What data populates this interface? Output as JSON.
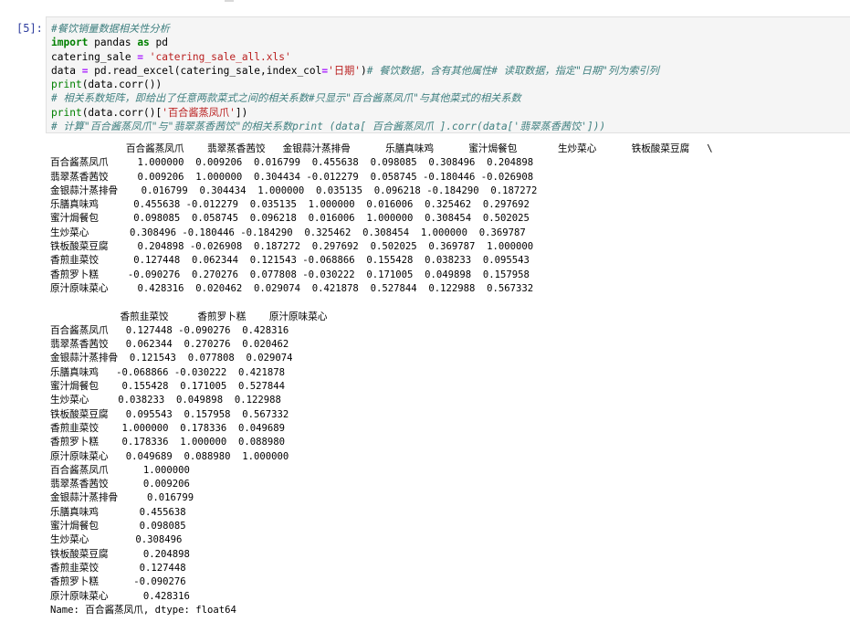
{
  "cell": {
    "prompt": "[5]:",
    "code": {
      "line1": "#餐饮销量数据相关性分析",
      "line2_kw1": "import",
      "line2_mod": " pandas ",
      "line2_kw2": "as",
      "line2_alias": " pd",
      "line3_var": "catering_sale ",
      "line3_op": "=",
      "line3_str": " 'catering_sale_all.xls'",
      "line4_a": "data ",
      "line4_op": "=",
      "line4_b": " pd.read_excel(catering_sale,index_col",
      "line4_op2": "=",
      "line4_str": "'日期'",
      "line4_c": ")",
      "line4_comment": "# 餐饮数据，含有其他属性# 读取数据，指定\"日期\"列为索引列",
      "line5_fn": "print",
      "line5_rest": "(data.corr())",
      "line6": "# 相关系数矩阵，即给出了任意两款菜式之间的相关系数#只显示\"百合酱蒸凤爪\"与其他菜式的相关系数",
      "line7_fn": "print",
      "line7_a": "(data.corr()[",
      "line7_str": "'百合酱蒸凤爪'",
      "line7_b": "])",
      "line8": "# 计算\"百合酱蒸凤爪\"与\"翡翠蒸香茜饺\"的相关系数print (data[ 百合酱蒸凤爪 ].corr(data['翡翠蒸香茜饺']))"
    },
    "output": {
      "block1_header": "             百合酱蒸凤爪    翡翠蒸香茜饺   金银蒜汁蒸排骨      乐膳真味鸡      蜜汁焗餐包       生炒菜心      铁板酸菜豆腐   \\",
      "block1_rows": [
        "百合酱蒸凤爪     1.000000  0.009206  0.016799  0.455638  0.098085  0.308496  0.204898",
        "翡翠蒸香茜饺     0.009206  1.000000  0.304434 -0.012279  0.058745 -0.180446 -0.026908",
        "金银蒜汁蒸排骨    0.016799  0.304434  1.000000  0.035135  0.096218 -0.184290  0.187272",
        "乐膳真味鸡      0.455638 -0.012279  0.035135  1.000000  0.016006  0.325462  0.297692",
        "蜜汁焗餐包      0.098085  0.058745  0.096218  0.016006  1.000000  0.308454  0.502025",
        "生炒菜心       0.308496 -0.180446 -0.184290  0.325462  0.308454  1.000000  0.369787",
        "铁板酸菜豆腐     0.204898 -0.026908  0.187272  0.297692  0.502025  0.369787  1.000000",
        "香煎韭菜饺      0.127448  0.062344  0.121543 -0.068866  0.155428  0.038233  0.095543",
        "香煎罗卜糕     -0.090276  0.270276  0.077808 -0.030222  0.171005  0.049898  0.157958",
        "原汁原味菜心     0.428316  0.020462  0.029074  0.421878  0.527844  0.122988  0.567332"
      ],
      "block2_header": "            香煎韭菜饺     香煎罗卜糕    原汁原味菜心",
      "block2_rows": [
        "百合酱蒸凤爪   0.127448 -0.090276  0.428316",
        "翡翠蒸香茜饺   0.062344  0.270276  0.020462",
        "金银蒜汁蒸排骨  0.121543  0.077808  0.029074",
        "乐膳真味鸡   -0.068866 -0.030222  0.421878",
        "蜜汁焗餐包    0.155428  0.171005  0.527844",
        "生炒菜心     0.038233  0.049898  0.122988",
        "铁板酸菜豆腐   0.095543  0.157958  0.567332",
        "香煎韭菜饺    1.000000  0.178336  0.049689",
        "香煎罗卜糕    0.178336  1.000000  0.088980",
        "原汁原味菜心   0.049689  0.088980  1.000000"
      ],
      "series_rows": [
        "百合酱蒸凤爪      1.000000",
        "翡翠蒸香茜饺      0.009206",
        "金银蒜汁蒸排骨     0.016799",
        "乐膳真味鸡       0.455638",
        "蜜汁焗餐包       0.098085",
        "生炒菜心        0.308496",
        "铁板酸菜豆腐      0.204898",
        "香煎韭菜饺       0.127448",
        "香煎罗卜糕      -0.090276",
        "原汁原味菜心      0.428316"
      ],
      "series_footer": "Name: 百合酱蒸凤爪, dtype: float64"
    }
  },
  "colors": {
    "prompt": "#303f9f",
    "comment": "#408080",
    "keyword": "#008000",
    "string": "#ba2121",
    "input_bg": "#f5f5f5"
  }
}
